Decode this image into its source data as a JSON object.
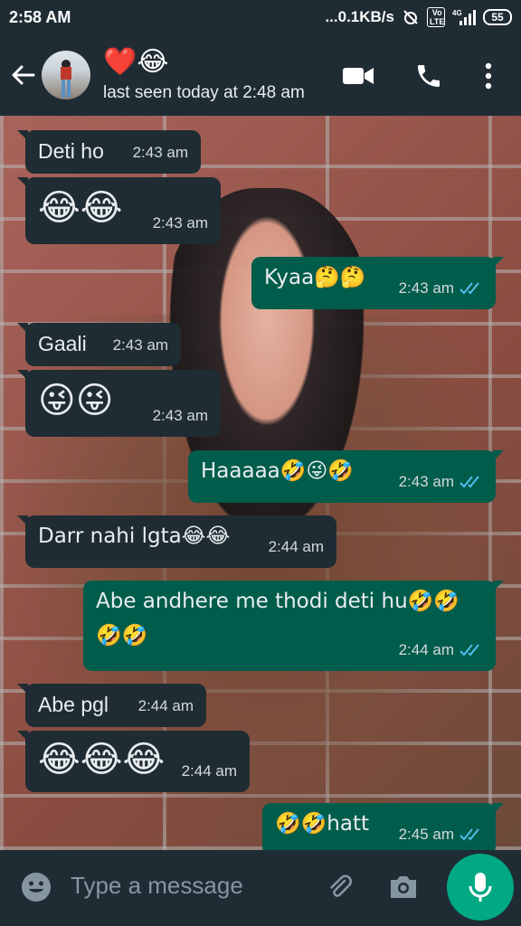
{
  "status_bar": {
    "time": "2:58 AM",
    "network_speed": "0.1KB/s",
    "signal_label": "4G",
    "volte": "Vo LTE",
    "battery": "55"
  },
  "header": {
    "contact_name": "❤️😂",
    "last_seen": "last seen today at 2:48 am"
  },
  "messages": [
    {
      "dir": "in",
      "text": "Deti ho",
      "time": "2:43 am"
    },
    {
      "dir": "in",
      "text": "😂😂",
      "time": "2:43 am"
    },
    {
      "dir": "out",
      "text": "Kyaa🤔🤔",
      "time": "2:43 am"
    },
    {
      "dir": "in",
      "text": "Gaali",
      "time": "2:43 am"
    },
    {
      "dir": "in",
      "text": "😜😜",
      "time": "2:43 am"
    },
    {
      "dir": "out",
      "text": "Haaaaa🤣😜🤣",
      "time": "2:43 am"
    },
    {
      "dir": "in",
      "text": "Darr nahi lgta😂😂",
      "time": "2:44 am"
    },
    {
      "dir": "out",
      "text": "Abe andhere me thodi deti hu🤣🤣",
      "text2": "🤣🤣",
      "time": "2:44 am"
    },
    {
      "dir": "in",
      "text": "Abe pgl",
      "time": "2:44 am"
    },
    {
      "dir": "in",
      "text": "😂😂😂",
      "time": "2:44 am"
    },
    {
      "dir": "out",
      "text": "🤣🤣hatt",
      "time": "2:45 am"
    }
  ],
  "composer": {
    "placeholder": "Type a message"
  },
  "icons": {
    "back": "arrow-left-icon",
    "video": "video-call-icon",
    "call": "phone-icon",
    "menu": "more-vert-icon",
    "emoji": "emoji-icon",
    "attach": "paperclip-icon",
    "camera": "camera-icon",
    "mic": "mic-icon",
    "read": "double-check-icon"
  },
  "colors": {
    "header_bg": "#1f2c34",
    "incoming_bubble": "#1f2c34",
    "outgoing_bubble": "#005c4b",
    "read_tick": "#53bdeb",
    "mic_button": "#00a884"
  }
}
